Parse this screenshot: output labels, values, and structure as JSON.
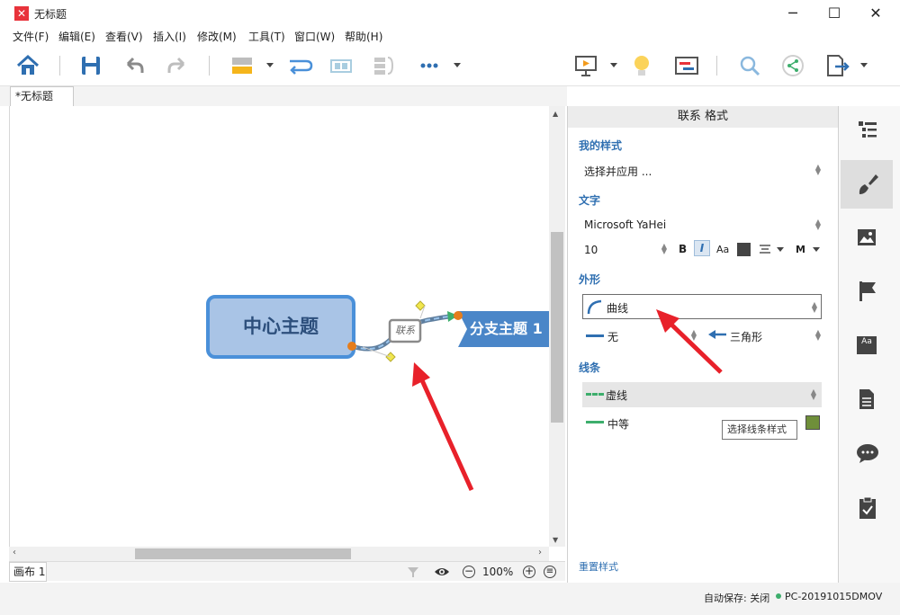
{
  "window": {
    "title": "无标题",
    "minimize": "─",
    "maximize": "☐",
    "close": "✕"
  },
  "menu": [
    "文件(F)",
    "编辑(E)",
    "查看(V)",
    "插入(I)",
    "修改(M)",
    "工具(T)",
    "窗口(W)",
    "帮助(H)"
  ],
  "doc_tab": "*无标题",
  "canvas": {
    "central_topic": "中心主题",
    "branch_topic": "分支主题 1",
    "relation_label": "联系"
  },
  "statusbar": {
    "sheet_tab": "画布 1",
    "zoom": "100%"
  },
  "panel": {
    "header": "联系 格式",
    "my_style_title": "我的样式",
    "my_style_value": "选择并应用 ...",
    "text_title": "文字",
    "font_name": "Microsoft YaHei",
    "font_size": "10",
    "bold": "B",
    "italic": "I",
    "case": "Aa",
    "weight": "M",
    "shape_title": "外形",
    "shape_value": "曲线",
    "start_arrow": "无",
    "end_arrow": "三角形",
    "line_title": "线条",
    "line_pattern": "虚线",
    "line_width": "中等",
    "reset": "重置样式"
  },
  "tooltip": "选择线条样式",
  "bottom": {
    "autosave": "自动保存: 关闭",
    "computer": "PC-20191015DMOV"
  },
  "colors": {
    "accent_blue": "#2f6fb1",
    "topic_fill": "#a9c4e6",
    "topic_border": "#4a90d9",
    "branch_fill": "#4a86c8",
    "arrow_red": "#e8212a",
    "line_green": "#3dae6c",
    "color_swatch": "#6f8f3a"
  }
}
